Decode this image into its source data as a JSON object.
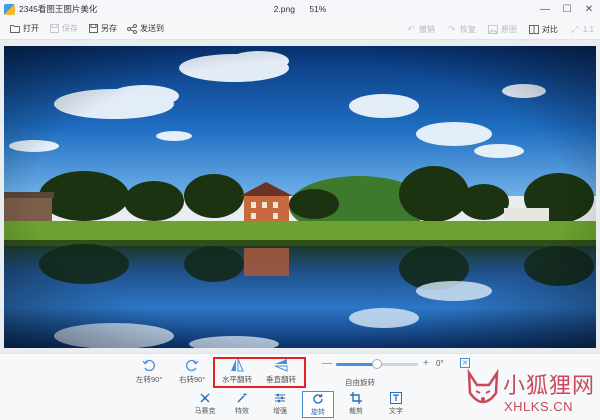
{
  "window": {
    "app_title": "2345看图王图片美化",
    "file_name": "2.png",
    "zoom": "51%",
    "controls": [
      "—",
      "☐",
      "✕"
    ]
  },
  "toolbar": {
    "open": "打开",
    "save": "保存",
    "save_as": "另存",
    "send_to": "发送到",
    "undo": "撤销",
    "redo": "恢复",
    "original": "原图",
    "compare": "对比",
    "ratio": "1:1"
  },
  "photo": {
    "description_colors": {
      "sky_top": "#0a3f8c",
      "sky_mid": "#2f7fcf",
      "water": "#0f4a8e",
      "grass": "#6aa22e",
      "trees": "#1f3d16"
    }
  },
  "controls": {
    "rotate_left": "左转90°",
    "rotate_right": "右转90°",
    "flip_horizontal": "水平翻转",
    "flip_vertical": "垂直翻转",
    "free_rotate": "自由旋转",
    "angle": "0°",
    "minus": "—",
    "plus": "+",
    "slider_value": 0.5
  },
  "tabs": [
    {
      "label": "马赛克",
      "icon": "mosaic-icon"
    },
    {
      "label": "特效",
      "icon": "magic-wand-icon"
    },
    {
      "label": "增强",
      "icon": "sliders-icon"
    },
    {
      "label": "旋转",
      "icon": "rotate-icon",
      "active": true
    },
    {
      "label": "裁剪",
      "icon": "crop-icon"
    },
    {
      "label": "文字",
      "icon": "text-icon"
    }
  ],
  "watermark": {
    "title": "小狐狸网",
    "subtitle": "XHLKS.CN"
  },
  "colors": {
    "accent": "#4a90d9",
    "highlight": "#e52222",
    "watermark": "#c94a5a"
  }
}
